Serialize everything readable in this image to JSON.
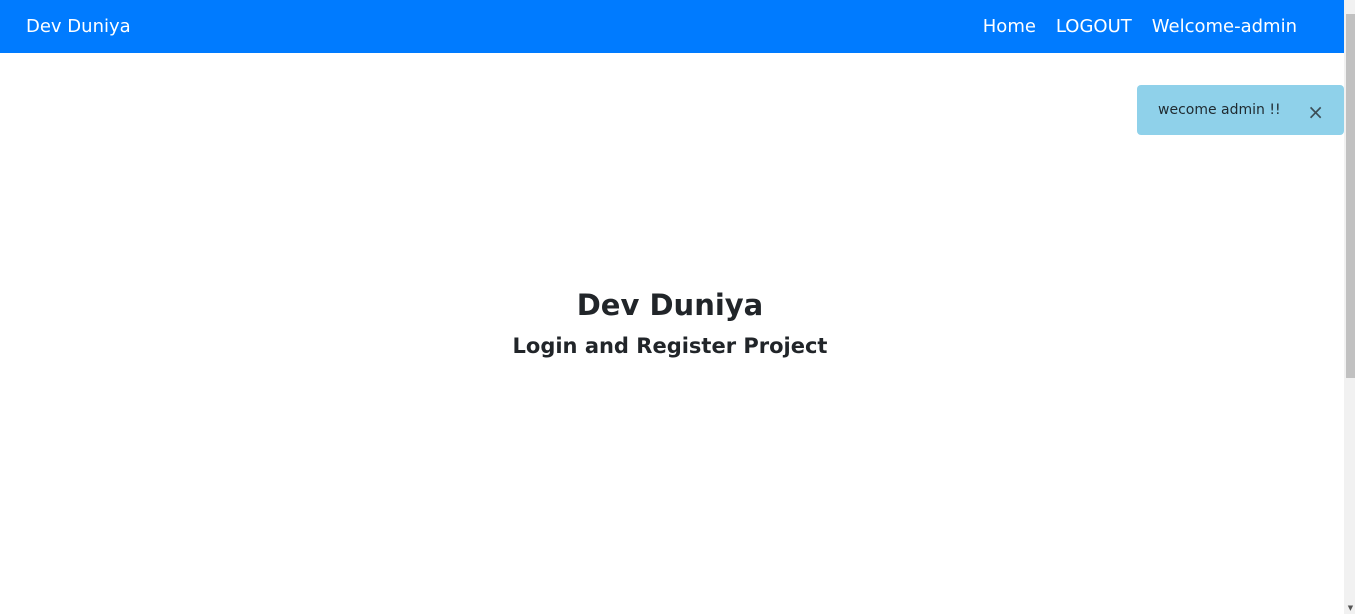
{
  "navbar": {
    "brand": "Dev Duniya",
    "links": [
      "Home",
      "LOGOUT",
      "Welcome-admin"
    ],
    "background_color": "#007bff"
  },
  "toast": {
    "message": "wecome admin !!",
    "close_symbol": "×",
    "background_color": "#8fd1ea"
  },
  "hero": {
    "title": "Dev Duniya",
    "subtitle": "Login and Register Project"
  }
}
